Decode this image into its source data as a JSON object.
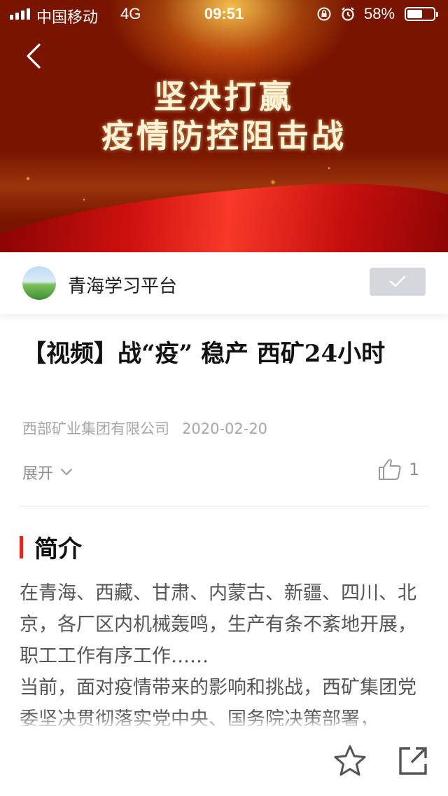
{
  "status_bar": {
    "carrier": "中国移动",
    "network": "4G",
    "time": "09:51",
    "battery_percent_text": "58%",
    "battery_level": 0.58
  },
  "video": {
    "headline_line1": "坚决打赢",
    "headline_line2": "疫情防控阻击战"
  },
  "channel": {
    "name": "青海学习平台",
    "followed": true
  },
  "article": {
    "title": "【视频】战“疫” 稳产 西矿24小时",
    "source": "西部矿业集团有限公司",
    "date": "2020-02-20",
    "expand_label": "展开",
    "like_count": "1"
  },
  "intro": {
    "heading": "简介",
    "paragraph1": "在青海、西藏、甘肃、内蒙古、新疆、四川、北京，各厂区内机械轰鸣，生产有条不紊地开展，职工工作有序工作……",
    "paragraph2": "当前，面对疫情带来的影响和挑战，西矿集团党委坚决贯彻落实党中央、国务院决策部署，"
  },
  "colors": {
    "accent_red": "#e0271f",
    "follow_button_bg": "#d4d7dc",
    "meta_gray": "#a7a7a7"
  },
  "icons": {
    "back": "chevron-left-icon",
    "follow": "check-icon",
    "expand": "chevron-down-icon",
    "like": "thumbs-up-icon",
    "favorite": "star-icon",
    "share": "share-icon"
  }
}
